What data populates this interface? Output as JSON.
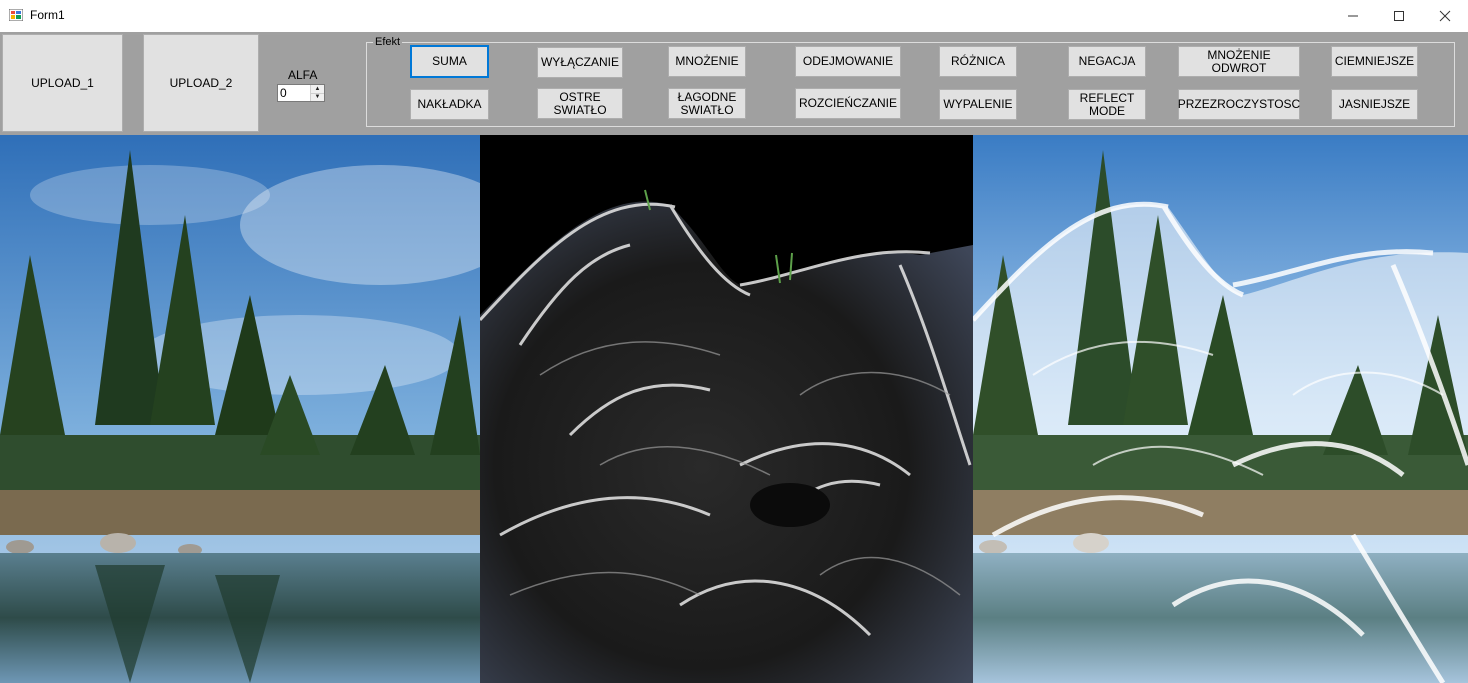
{
  "window": {
    "title": "Form1",
    "minimize": "—",
    "maximize": "☐",
    "close": "✕"
  },
  "toolbar": {
    "upload1": "UPLOAD_1",
    "upload2": "UPLOAD_2",
    "alfa_label": "ALFA",
    "alfa_value": "0"
  },
  "effects": {
    "legend": "Efekt",
    "row1": [
      "SUMA",
      "WYŁĄCZANIE",
      "MNOŻENIE",
      "ODEJMOWANIE",
      "RÓŻNICA",
      "NEGACJA",
      "MNOŻENIE ODWROT",
      "CIEMNIEJSZE"
    ],
    "row2": [
      "NAKŁADKA",
      "OSTRE\nSWIATŁO",
      "ŁAGODNE\nSWIATŁO",
      "ROZCIEŃCZANIE",
      "WYPALENIE",
      "REFLECT\nMODE",
      "PRZEZROCZYSTOSC",
      "JASNIEJSZE"
    ],
    "active": "SUMA"
  },
  "images": {
    "left": "forest-lake-photo",
    "middle": "fractal-wolf-photo",
    "right": "blended-result-photo"
  },
  "colors": {
    "accent": "#0078d7",
    "control_bg": "#e1e1e1",
    "form_bg": "#a0a0a0"
  }
}
